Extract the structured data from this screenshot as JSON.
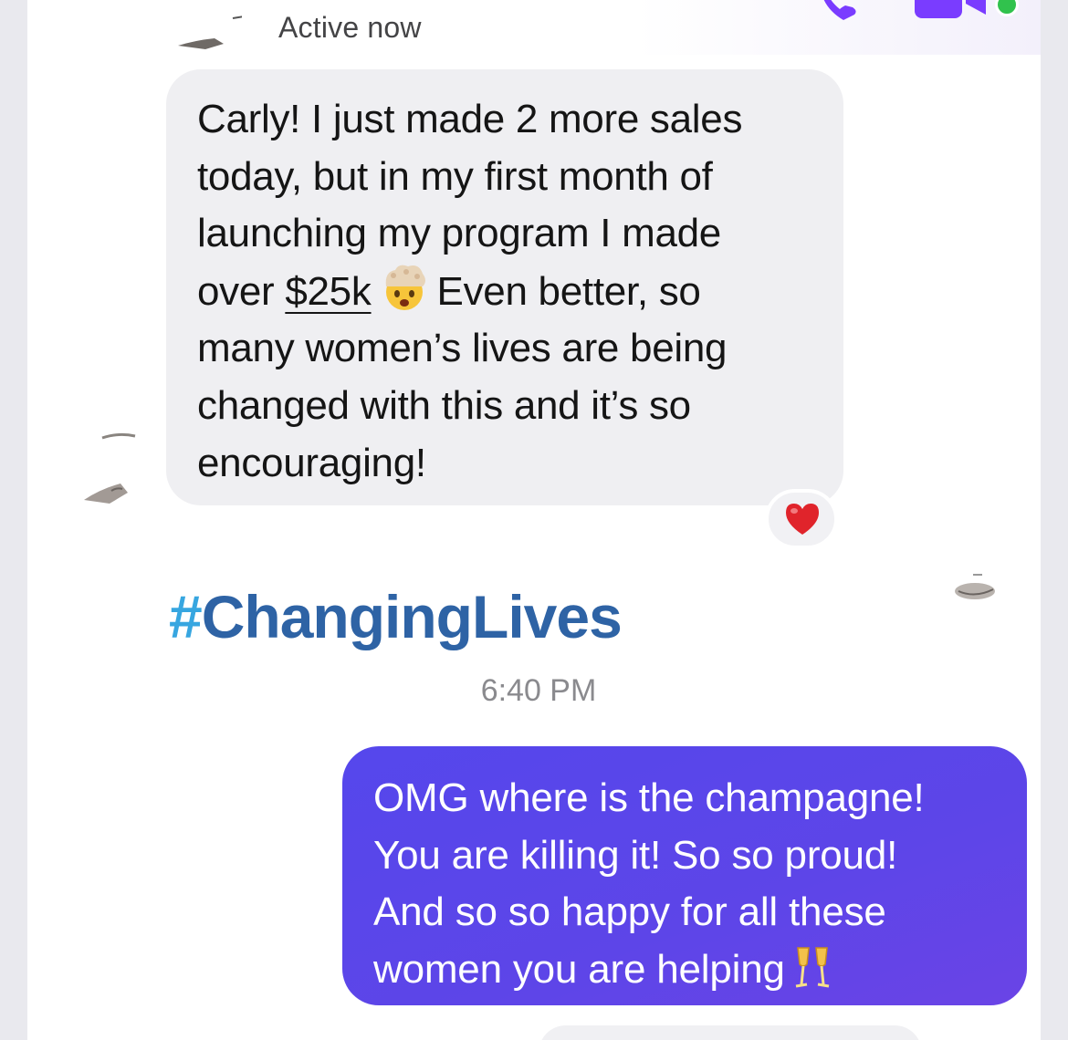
{
  "header": {
    "status": "Active now"
  },
  "incoming_message": {
    "line1": "Carly! I just made 2 more sales",
    "line2": "today, but in my first month of",
    "line3": "launching my program I made",
    "line4_before": "over ",
    "amount": "$25k",
    "line4_after": "Even better, so",
    "line5": "many women’s lives are being",
    "line6": "changed with this and it’s so",
    "line7": "encouraging!",
    "emoji_icon": "mind-blown-emoji",
    "reaction_icon": "heart-icon",
    "reaction_color": "#e0242b"
  },
  "hashtag": {
    "symbol": "#",
    "text": "ChangingLives",
    "symbol_color": "#37a6e0",
    "text_color": "#2e63a5"
  },
  "timestamp": "6:40 PM",
  "outgoing_message": {
    "line1": "OMG where is the champagne!",
    "line2": "You are killing it! So so proud!",
    "line3": "And so so happy for all these",
    "line4": "women you are helping",
    "emoji_icon": "champagne-glasses-emoji",
    "bubble_color": "#5a46eb"
  },
  "colors": {
    "accent": "#7a3cff",
    "online": "#31c24d"
  }
}
